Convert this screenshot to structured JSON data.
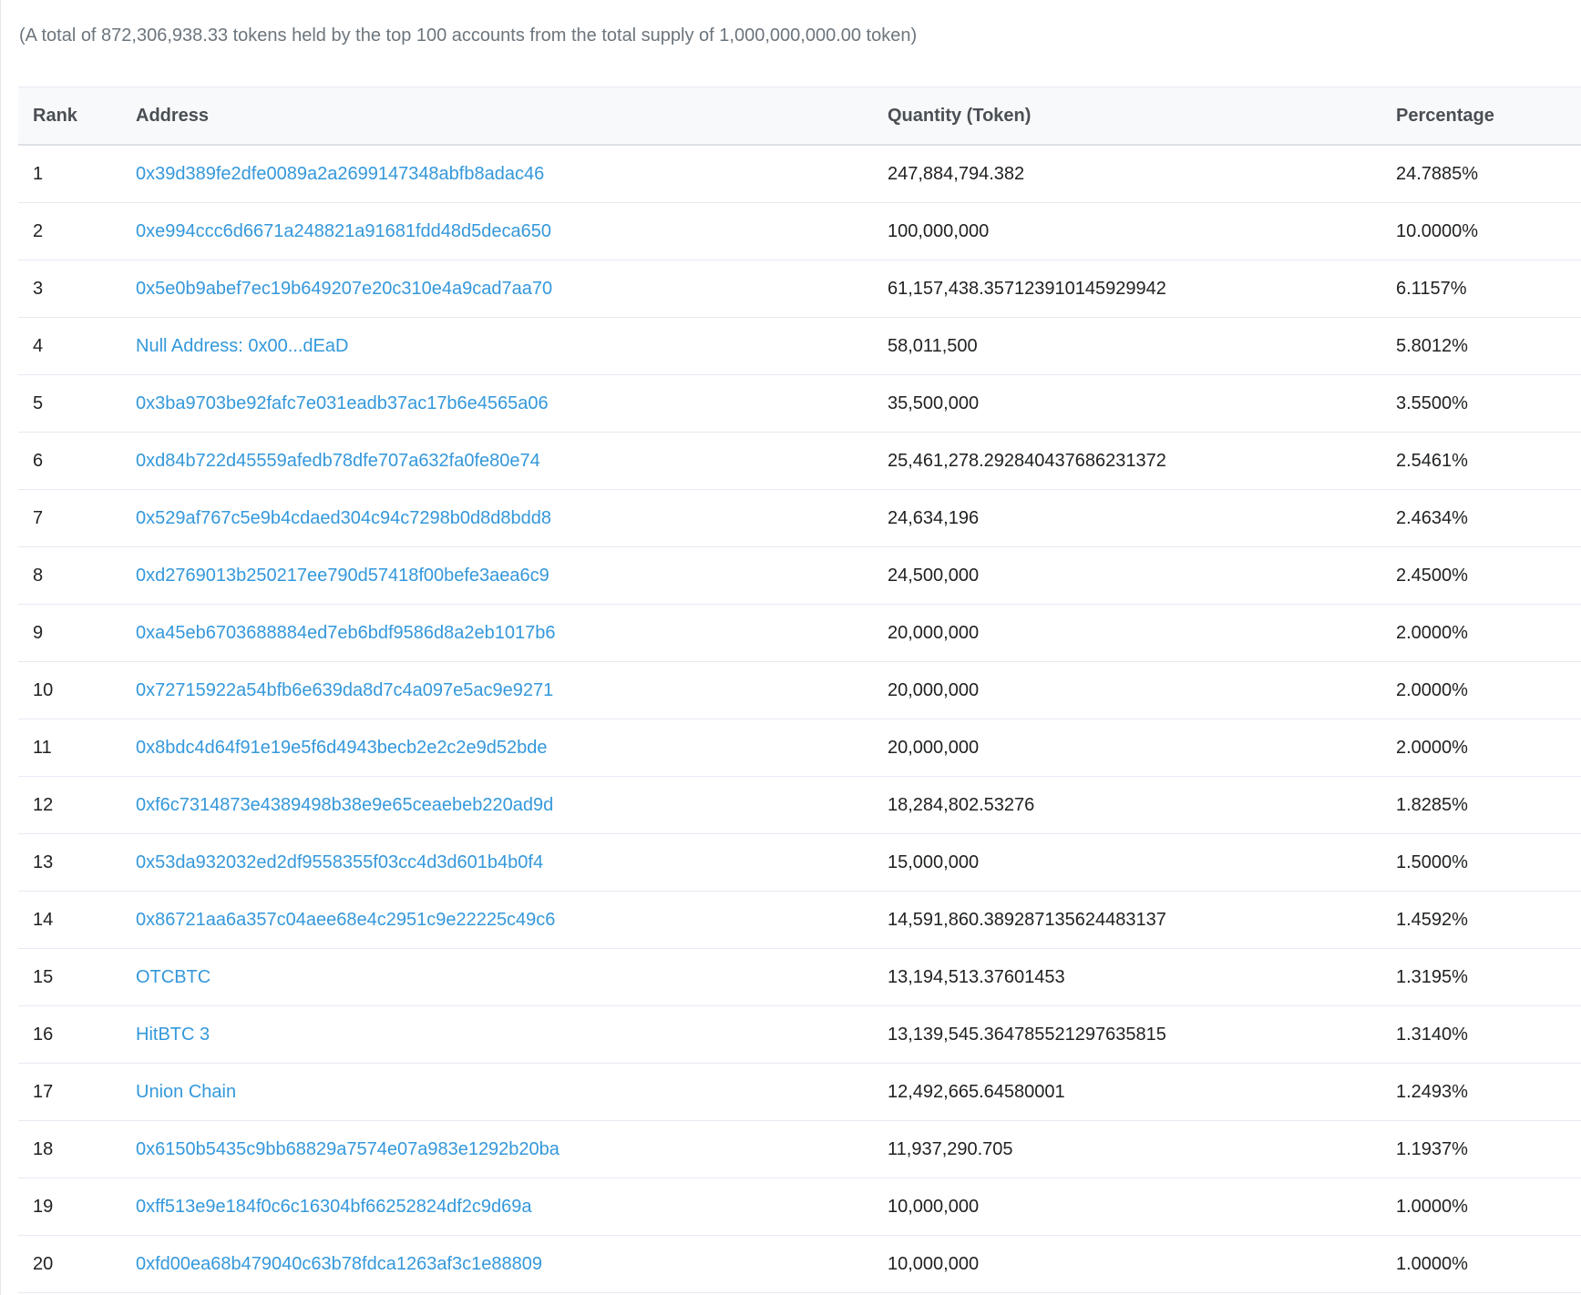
{
  "summary": "(A total of 872,306,938.33 tokens held by the top 100 accounts from the total supply of 1,000,000,000.00 token)",
  "columns": {
    "rank": "Rank",
    "address": "Address",
    "quantity": "Quantity (Token)",
    "percentage": "Percentage"
  },
  "colors": {
    "link": "#3498db",
    "header_bg": "#f8f9fa",
    "summary_text": "#6c757d"
  },
  "rows": [
    {
      "rank": "1",
      "address": "0x39d389fe2dfe0089a2a2699147348abfb8adac46",
      "quantity": "247,884,794.382",
      "percentage": "24.7885%"
    },
    {
      "rank": "2",
      "address": "0xe994ccc6d6671a248821a91681fdd48d5deca650",
      "quantity": "100,000,000",
      "percentage": "10.0000%"
    },
    {
      "rank": "3",
      "address": "0x5e0b9abef7ec19b649207e20c310e4a9cad7aa70",
      "quantity": "61,157,438.357123910145929942",
      "percentage": "6.1157%"
    },
    {
      "rank": "4",
      "address": "Null Address: 0x00...dEaD",
      "quantity": "58,011,500",
      "percentage": "5.8012%"
    },
    {
      "rank": "5",
      "address": "0x3ba9703be92fafc7e031eadb37ac17b6e4565a06",
      "quantity": "35,500,000",
      "percentage": "3.5500%"
    },
    {
      "rank": "6",
      "address": "0xd84b722d45559afedb78dfe707a632fa0fe80e74",
      "quantity": "25,461,278.292840437686231372",
      "percentage": "2.5461%"
    },
    {
      "rank": "7",
      "address": "0x529af767c5e9b4cdaed304c94c7298b0d8d8bdd8",
      "quantity": "24,634,196",
      "percentage": "2.4634%"
    },
    {
      "rank": "8",
      "address": "0xd2769013b250217ee790d57418f00befe3aea6c9",
      "quantity": "24,500,000",
      "percentage": "2.4500%"
    },
    {
      "rank": "9",
      "address": "0xa45eb6703688884ed7eb6bdf9586d8a2eb1017b6",
      "quantity": "20,000,000",
      "percentage": "2.0000%"
    },
    {
      "rank": "10",
      "address": "0x72715922a54bfb6e639da8d7c4a097e5ac9e9271",
      "quantity": "20,000,000",
      "percentage": "2.0000%"
    },
    {
      "rank": "11",
      "address": "0x8bdc4d64f91e19e5f6d4943becb2e2c2e9d52bde",
      "quantity": "20,000,000",
      "percentage": "2.0000%"
    },
    {
      "rank": "12",
      "address": "0xf6c7314873e4389498b38e9e65ceaebeb220ad9d",
      "quantity": "18,284,802.53276",
      "percentage": "1.8285%"
    },
    {
      "rank": "13",
      "address": "0x53da932032ed2df9558355f03cc4d3d601b4b0f4",
      "quantity": "15,000,000",
      "percentage": "1.5000%"
    },
    {
      "rank": "14",
      "address": "0x86721aa6a357c04aee68e4c2951c9e22225c49c6",
      "quantity": "14,591,860.389287135624483137",
      "percentage": "1.4592%"
    },
    {
      "rank": "15",
      "address": "OTCBTC",
      "quantity": "13,194,513.37601453",
      "percentage": "1.3195%"
    },
    {
      "rank": "16",
      "address": "HitBTC 3",
      "quantity": "13,139,545.364785521297635815",
      "percentage": "1.3140%"
    },
    {
      "rank": "17",
      "address": "Union Chain",
      "quantity": "12,492,665.64580001",
      "percentage": "1.2493%"
    },
    {
      "rank": "18",
      "address": "0x6150b5435c9bb68829a7574e07a983e1292b20ba",
      "quantity": "11,937,290.705",
      "percentage": "1.1937%"
    },
    {
      "rank": "19",
      "address": "0xff513e9e184f0c6c16304bf66252824df2c9d69a",
      "quantity": "10,000,000",
      "percentage": "1.0000%"
    },
    {
      "rank": "20",
      "address": "0xfd00ea68b479040c63b78fdca1263af3c1e88809",
      "quantity": "10,000,000",
      "percentage": "1.0000%"
    }
  ]
}
